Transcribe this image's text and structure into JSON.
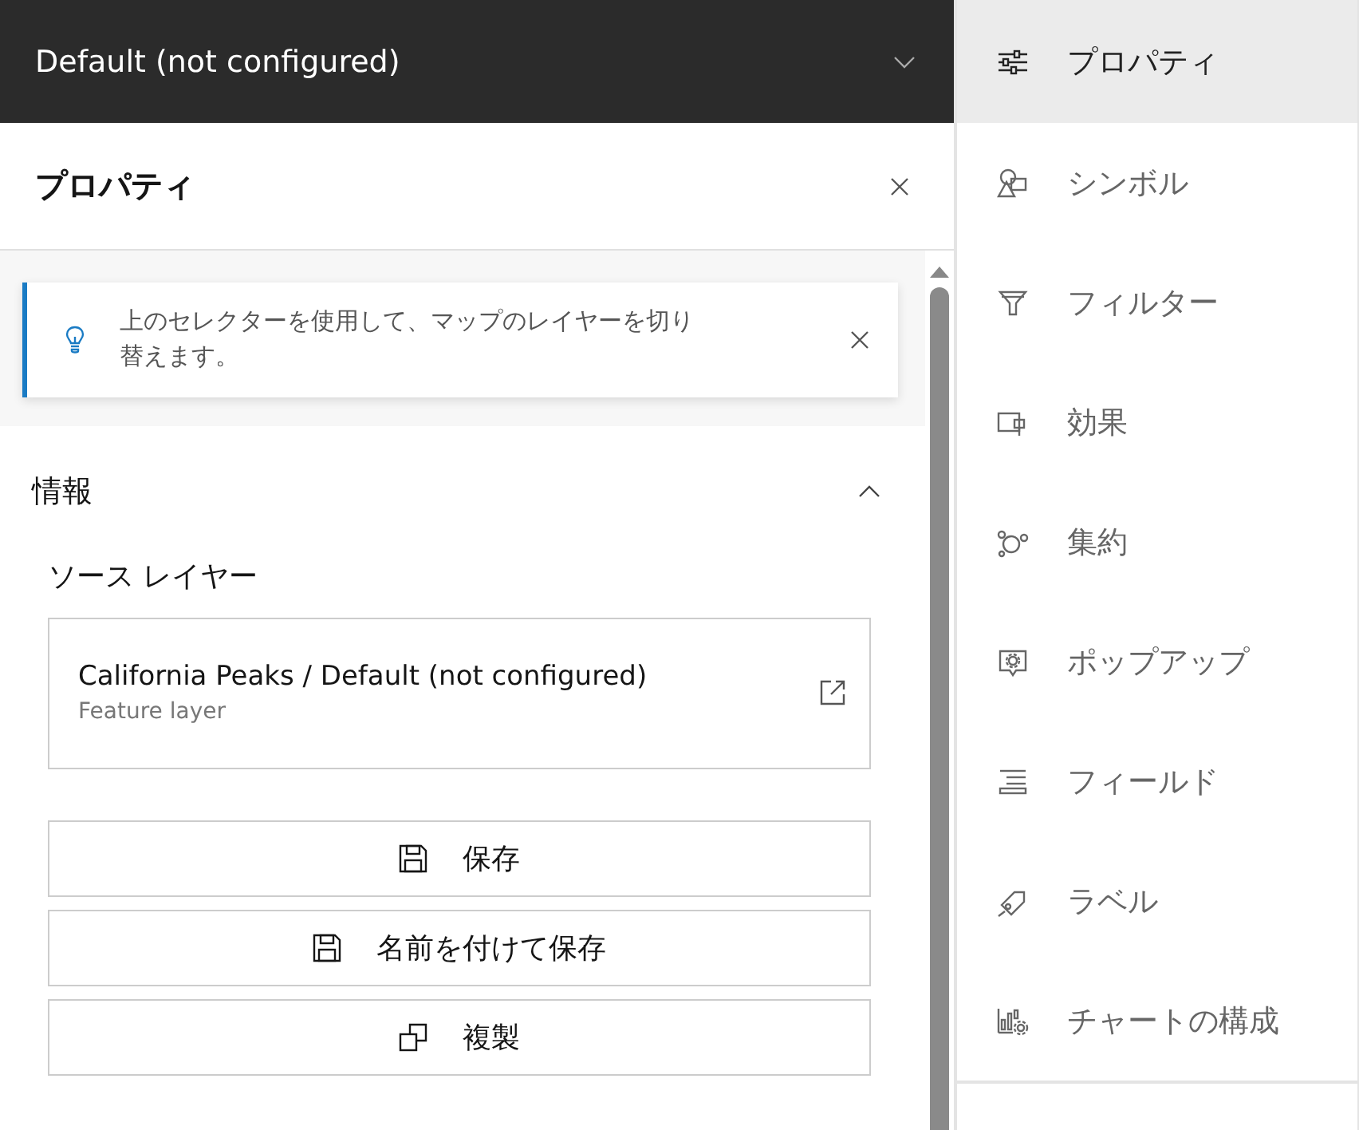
{
  "layer_selector": {
    "value": "Default (not configured)"
  },
  "panel": {
    "title": "プロパティ"
  },
  "notice": {
    "text": "上のセレクターを使用して、マップのレイヤーを切り替えます。"
  },
  "section": {
    "title": "情報",
    "expanded": true,
    "source_label": "ソース レイヤー",
    "source_layer": {
      "name": "California Peaks / Default (not configured)",
      "type": "Feature layer"
    },
    "actions": [
      {
        "kind": "save",
        "label": "保存"
      },
      {
        "kind": "save",
        "label": "名前を付けて保存"
      },
      {
        "kind": "duplicate",
        "label": "複製"
      }
    ]
  },
  "sidebar": {
    "items": [
      {
        "kind": "properties",
        "label": "プロパティ",
        "selected": true
      },
      {
        "kind": "symbols",
        "label": "シンボル",
        "selected": false
      },
      {
        "kind": "filter",
        "label": "フィルター",
        "selected": false
      },
      {
        "kind": "effects",
        "label": "効果",
        "selected": false
      },
      {
        "kind": "aggregation",
        "label": "集約",
        "selected": false
      },
      {
        "kind": "popup",
        "label": "ポップアップ",
        "selected": false
      },
      {
        "kind": "fields",
        "label": "フィールド",
        "selected": false
      },
      {
        "kind": "labels",
        "label": "ラベル",
        "selected": false
      },
      {
        "kind": "charts",
        "label": "チャートの構成",
        "selected": false
      }
    ]
  }
}
